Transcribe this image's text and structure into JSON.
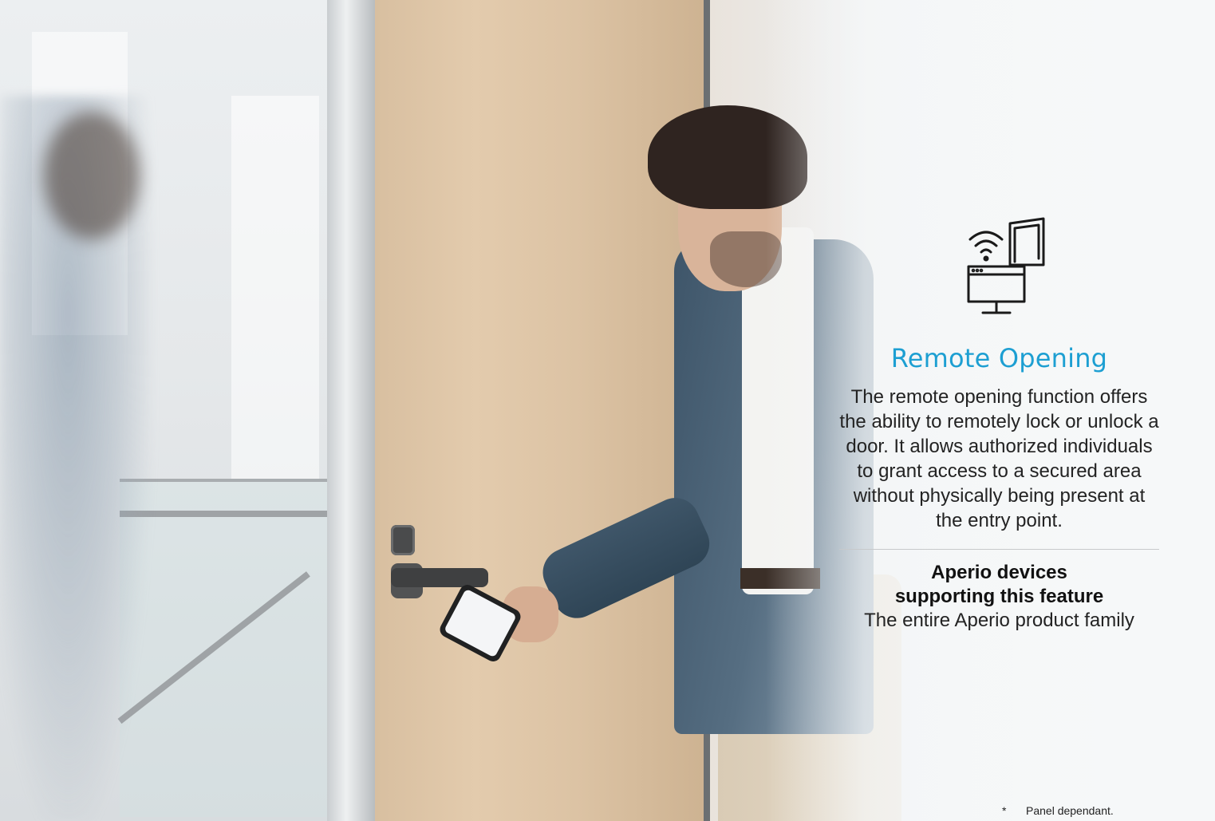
{
  "feature": {
    "icon": "wifi-monitor-door-icon",
    "title": "Remote Opening",
    "description": "The remote opening function offers the ability to remotely lock or unlock a door. It allows authorized individuals to grant access to a secured area without physically being present at the entry point.",
    "accent_color": "#1d9fd2"
  },
  "support": {
    "title_line1": "Aperio devices",
    "title_line2": "supporting this feature",
    "value": "The entire Aperio product family"
  },
  "footnote": {
    "marker": "*",
    "text": "Panel dependant."
  }
}
